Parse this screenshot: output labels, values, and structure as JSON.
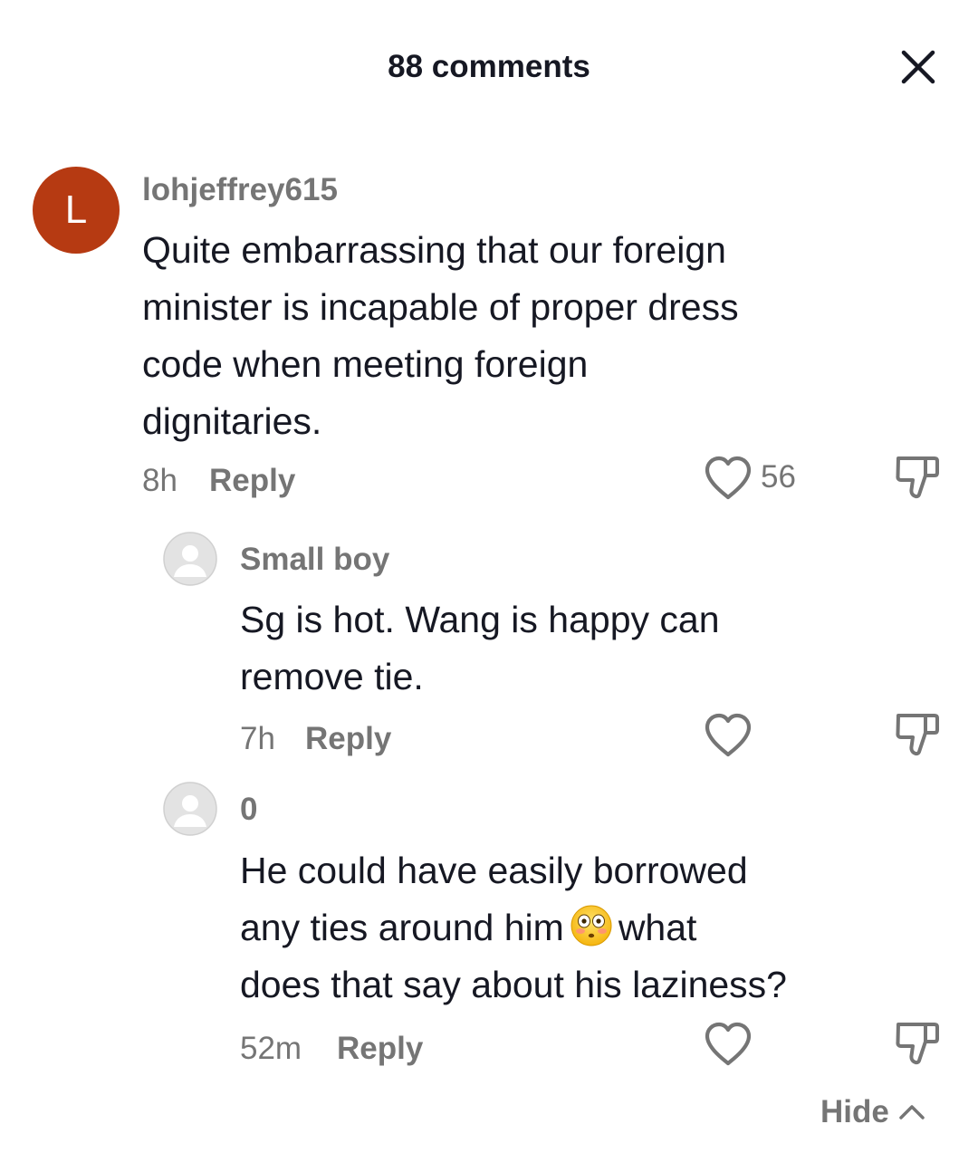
{
  "header": {
    "title": "88 comments",
    "close_icon": "close-icon"
  },
  "comments": [
    {
      "avatar_letter": "L",
      "avatar_color": "#b63a12",
      "username": "lohjeffrey615",
      "text_lines": [
        "Quite embarrassing that our foreign",
        "minister is incapable of proper dress",
        "code when meeting foreign",
        "dignitaries."
      ],
      "time": "8h",
      "reply_label": "Reply",
      "likes": "56"
    }
  ],
  "replies": [
    {
      "avatar_icon": "default-avatar-icon",
      "username": "Small boy",
      "text_lines": [
        "Sg is hot. Wang is happy can",
        "remove tie."
      ],
      "time": "7h",
      "reply_label": "Reply"
    },
    {
      "avatar_icon": "default-avatar-icon",
      "username": "0",
      "text_lines": [
        "He could have easily borrowed",
        "any ties around him",
        "what",
        "does that say about his laziness?"
      ],
      "emoji": "flushed-face-emoji",
      "time": "52m",
      "reply_label": "Reply"
    }
  ],
  "footer": {
    "hide_label": "Hide"
  },
  "colors": {
    "text_primary": "#161823",
    "text_secondary": "#757575",
    "avatar_default_bg": "#e3e3e3"
  }
}
